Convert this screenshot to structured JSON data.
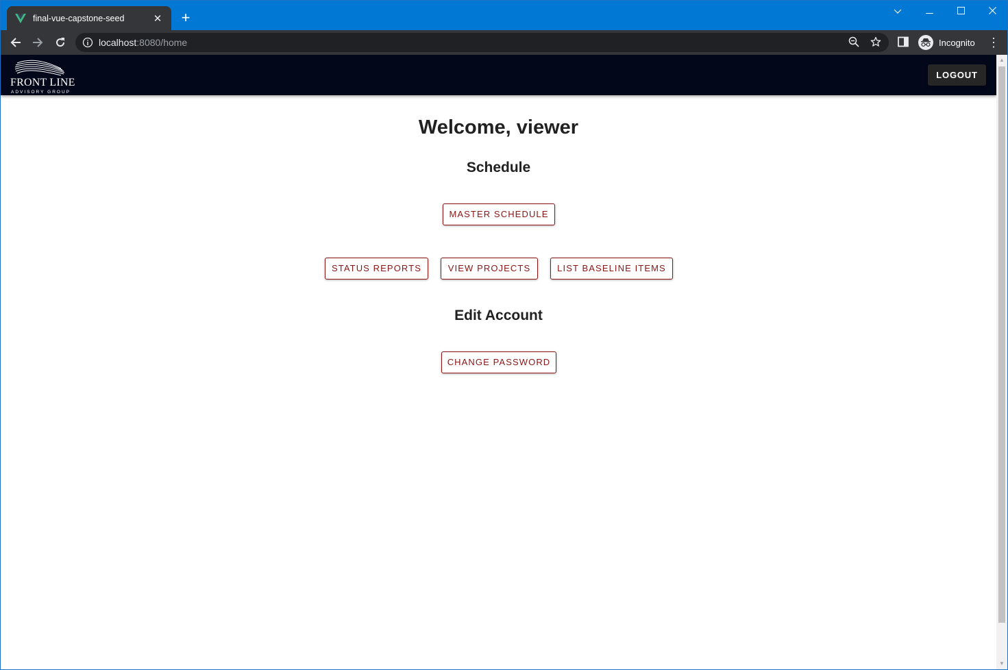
{
  "browser": {
    "tab_title": "final-vue-capstone-seed",
    "url_host": "localhost",
    "url_rest": ":8080/home",
    "profile_label": "Incognito",
    "accent_color": "#0078d4"
  },
  "app": {
    "logo_text": "FRONT LINE",
    "logo_subtext": "ADVISORY GROUP",
    "logout_label": "LOGOUT",
    "welcome": "Welcome, viewer",
    "schedule_heading": "Schedule",
    "master_schedule_label": "MASTER SCHEDULE",
    "status_reports_label": "STATUS REPORTS",
    "view_projects_label": "VIEW PROJECTS",
    "list_baseline_label": "LIST BASELINE ITEMS",
    "edit_account_heading": "Edit Account",
    "change_password_label": "CHANGE PASSWORD",
    "button_color": "#8b1414",
    "header_color": "#02071a"
  }
}
